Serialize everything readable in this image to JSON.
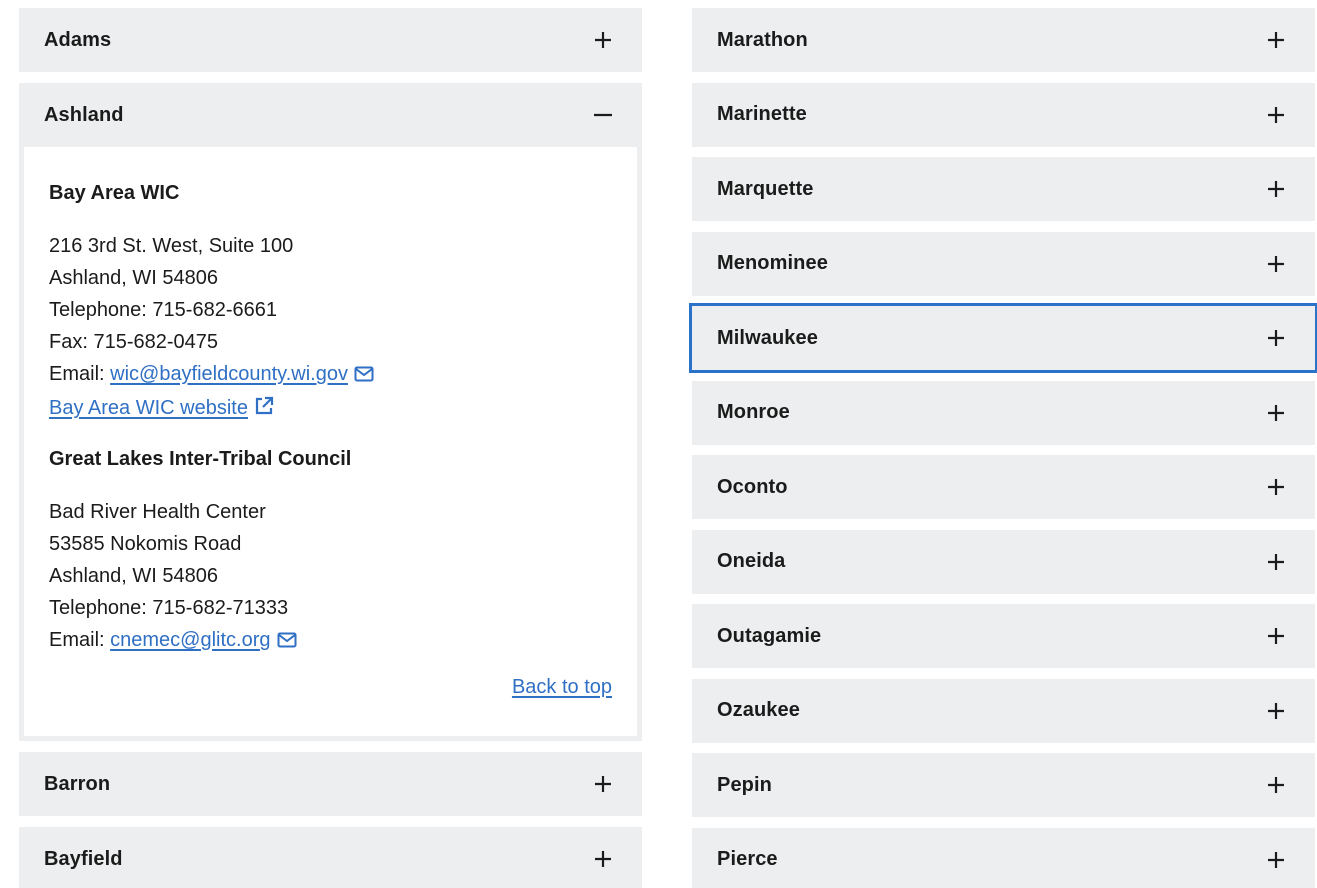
{
  "left_column": {
    "items": [
      {
        "label": "Adams",
        "state": "collapsed"
      },
      {
        "label": "Ashland",
        "state": "expanded"
      },
      {
        "label": "Barron",
        "state": "collapsed"
      },
      {
        "label": "Bayfield",
        "state": "collapsed"
      }
    ],
    "ashland_panel": {
      "org1": {
        "name": "Bay Area WIC",
        "address1": "216 3rd St. West, Suite 100",
        "address2": "Ashland, WI 54806",
        "telephone": "Telephone: 715-682-6661",
        "fax": "Fax: 715-682-0475",
        "email_label": "Email: ",
        "email": "wic@bayfieldcounty.wi.gov",
        "website": "Bay Area WIC website"
      },
      "org2": {
        "name": "Great Lakes Inter-Tribal Council",
        "line1": "Bad River Health Center",
        "line2": "53585 Nokomis Road",
        "line3": "Ashland, WI 54806",
        "telephone": "Telephone: 715-682-71333",
        "email_label": "Email: ",
        "email": "cnemec@glitc.org"
      },
      "back_to_top": "Back to top"
    }
  },
  "right_column": {
    "items": [
      {
        "label": "Marathon"
      },
      {
        "label": "Marinette"
      },
      {
        "label": "Marquette"
      },
      {
        "label": "Menominee"
      },
      {
        "label": "Milwaukee",
        "focused": true
      },
      {
        "label": "Monroe"
      },
      {
        "label": "Oconto"
      },
      {
        "label": "Oneida"
      },
      {
        "label": "Outagamie"
      },
      {
        "label": "Ozaukee"
      },
      {
        "label": "Pepin"
      },
      {
        "label": "Pierce"
      }
    ]
  },
  "icons": {
    "expand": "plus-icon",
    "collapse": "minus-icon",
    "email": "envelope-icon",
    "external": "external-link-icon"
  },
  "colors": {
    "accordion_bg": "#eceeef",
    "link": "#2f6fc4",
    "focus_outline": "#2a73c9",
    "text": "#1b1b1b"
  }
}
